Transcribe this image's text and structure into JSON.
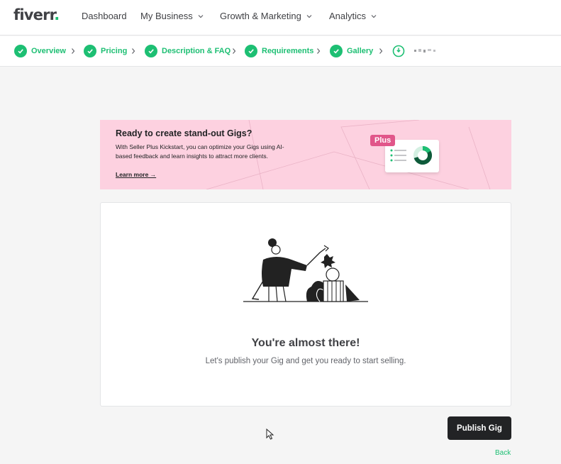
{
  "brand": {
    "logo_text": "fiverr",
    "logo_dot": ".",
    "accent": "#1dbf73",
    "dark": "#222325",
    "pink": "#fdd1e0",
    "plus_pink": "#e1568a"
  },
  "nav": {
    "items": [
      {
        "label": "Dashboard",
        "has_dropdown": false
      },
      {
        "label": "My Business",
        "has_dropdown": true,
        "icon": "chevron-down-icon"
      },
      {
        "label": "Growth & Marketing",
        "has_dropdown": true,
        "icon": "chevron-down-icon"
      },
      {
        "label": "Analytics",
        "has_dropdown": true,
        "icon": "chevron-down-icon"
      }
    ]
  },
  "steps": {
    "items": [
      {
        "label": "Overview",
        "completed": true,
        "icon": "check-circle-icon"
      },
      {
        "label": "Pricing",
        "completed": true,
        "icon": "check-circle-icon"
      },
      {
        "label": "Description & FAQ",
        "completed": true,
        "icon": "check-circle-icon"
      },
      {
        "label": "Requirements",
        "completed": true,
        "icon": "check-circle-icon"
      },
      {
        "label": "Gallery",
        "completed": true,
        "icon": "check-circle-icon"
      },
      {
        "label": "",
        "completed": false,
        "current": true,
        "icon": "publish-step-icon"
      }
    ],
    "separator_icon": "chevron-right-icon"
  },
  "banner": {
    "title": "Ready to create stand-out Gigs?",
    "body": "With Seller Plus Kickstart, you can optimize your Gigs using AI-based feedback and learn insights to attract more clients.",
    "link": "Learn more →",
    "badge": "Plus"
  },
  "main": {
    "illustration": "person-stacking-shapes-illustration",
    "title": "You're almost there!",
    "subtitle": "Let's publish your Gig and get you ready to start selling."
  },
  "actions": {
    "publish_label": "Publish Gig",
    "back_label": "Back"
  }
}
